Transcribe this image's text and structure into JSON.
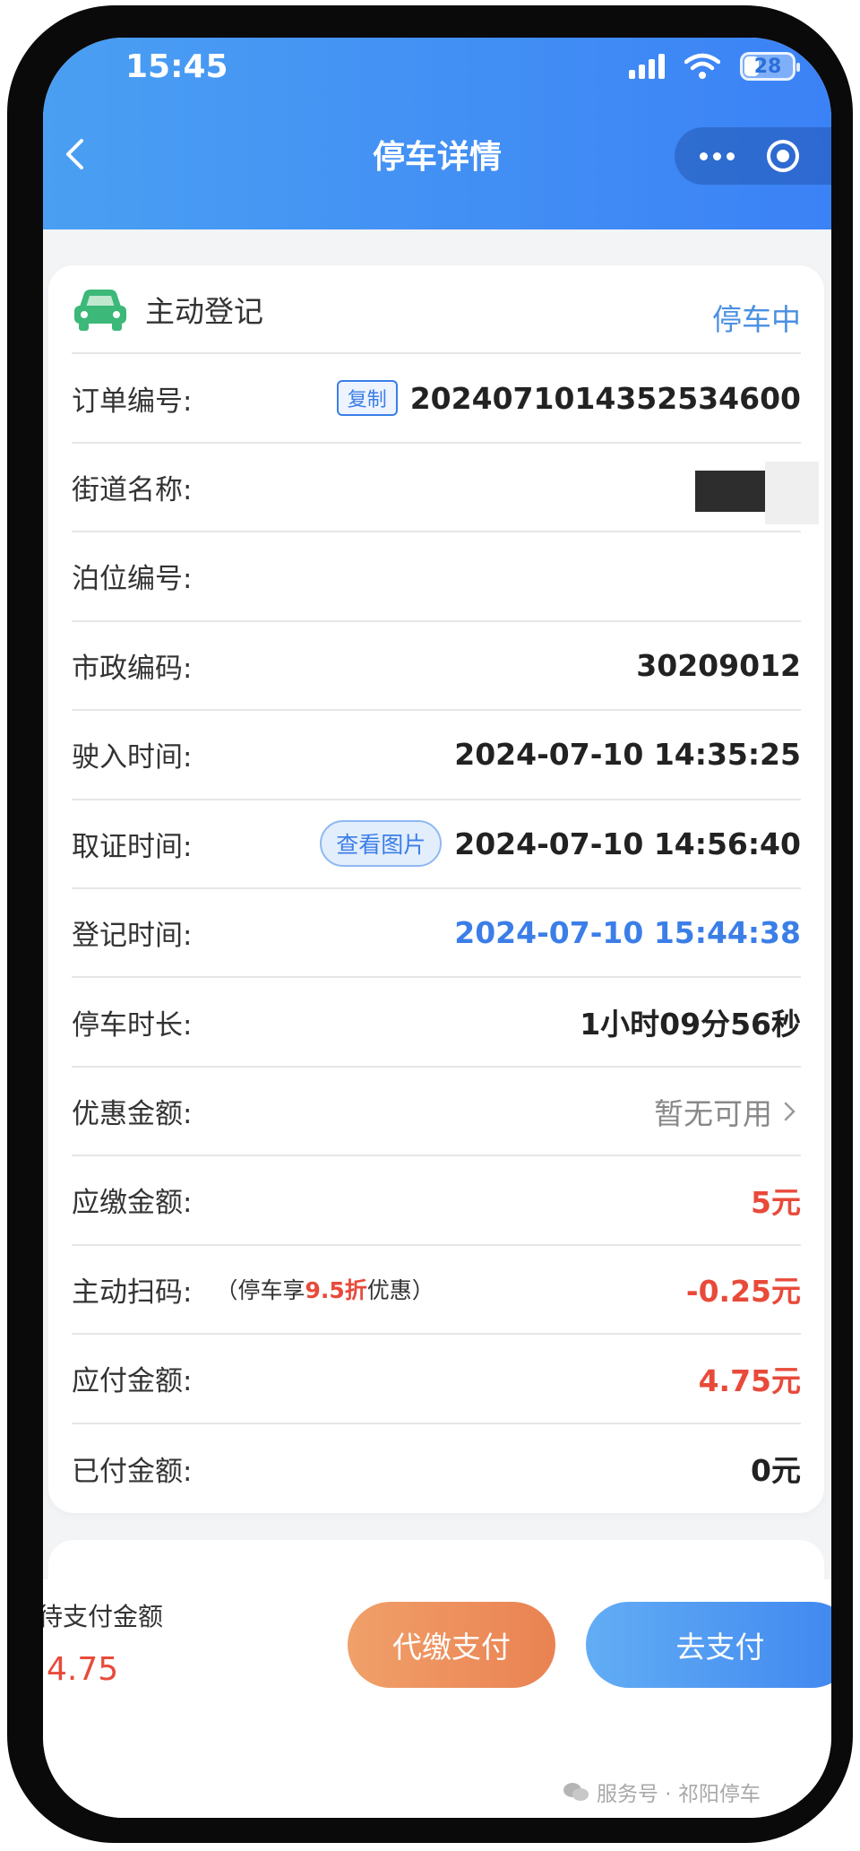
{
  "status_bar": {
    "time": "15:45",
    "battery": "28"
  },
  "header": {
    "title": "停车详情"
  },
  "card": {
    "head_title": "主动登记",
    "status": "停车中",
    "rows": [
      {
        "label": "订单编号:",
        "tag": "复制",
        "value": "20240710143525346​00"
      },
      {
        "label": "街道名称:",
        "value": ""
      },
      {
        "label": "泊位编号:",
        "value": ""
      },
      {
        "label": "市政编码:",
        "value": "30209012"
      },
      {
        "label": "驶入时间:",
        "value": "2024-07-10 14:35:25"
      },
      {
        "label": "取证时间:",
        "tag": "查看图片",
        "value": "2024-07-10 14:56:40"
      },
      {
        "label": "登记时间:",
        "value": "2024-07-10 15:44:38"
      },
      {
        "label": "停车时长:",
        "value": "1小时09分56秒"
      },
      {
        "label": "优惠金额:",
        "value": "暂无可用"
      },
      {
        "label": "应缴金额:",
        "value": "5元"
      },
      {
        "label": "主动扫码:",
        "note_prefix": "（停车享",
        "note_highlight": "9.5折",
        "note_suffix": "优惠）",
        "value": "-0.25元"
      },
      {
        "label": "应付金额:",
        "value": "4.75元"
      },
      {
        "label": "已付金额:",
        "value": "0元"
      }
    ]
  },
  "bottom": {
    "pending_label": "待支付金额",
    "pending_amount": "4.75",
    "proxy_pay_label": "代缴支付",
    "pay_label": "去支付"
  },
  "watermark": "服务号 · 祁阳停车",
  "colors": {
    "accent": "#3b82f6",
    "red": "#e84a3a",
    "orange": "#ea8252",
    "car_green": "#3cb878"
  }
}
